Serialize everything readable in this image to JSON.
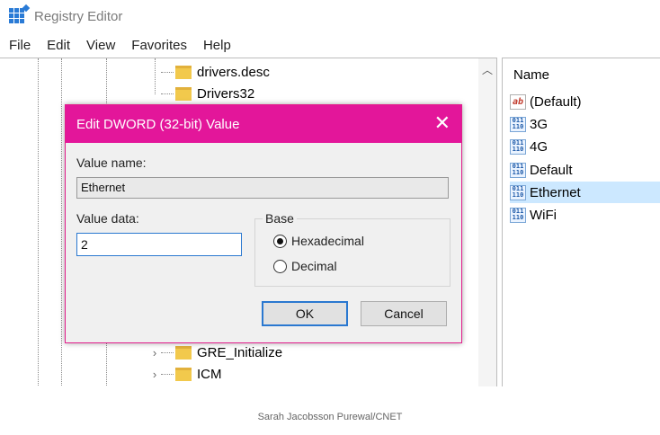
{
  "window": {
    "title": "Registry Editor"
  },
  "menu": [
    "File",
    "Edit",
    "View",
    "Favorites",
    "Help"
  ],
  "tree": {
    "top_nodes": [
      "drivers.desc",
      "Drivers32"
    ],
    "bottom_nodes": [
      "GRE_Initialize",
      "ICM"
    ]
  },
  "values_pane": {
    "column_name": "Name",
    "items": [
      {
        "name": "(Default)",
        "icon": "string-value-icon"
      },
      {
        "name": "3G",
        "icon": "binary-value-icon"
      },
      {
        "name": "4G",
        "icon": "binary-value-icon"
      },
      {
        "name": "Default",
        "icon": "binary-value-icon"
      },
      {
        "name": "Ethernet",
        "icon": "binary-value-icon"
      },
      {
        "name": "WiFi",
        "icon": "binary-value-icon"
      }
    ],
    "selected_index": 4
  },
  "dialog": {
    "title": "Edit DWORD (32-bit) Value",
    "value_name_label": "Value name:",
    "value_name": "Ethernet",
    "value_data_label": "Value data:",
    "value_data": "2",
    "base_label": "Base",
    "base_options": [
      "Hexadecimal",
      "Decimal"
    ],
    "base_selected": "Hexadecimal",
    "ok_label": "OK",
    "cancel_label": "Cancel",
    "accent_color": "#e3169a"
  },
  "credit": "Sarah Jacobsson Purewal/CNET"
}
